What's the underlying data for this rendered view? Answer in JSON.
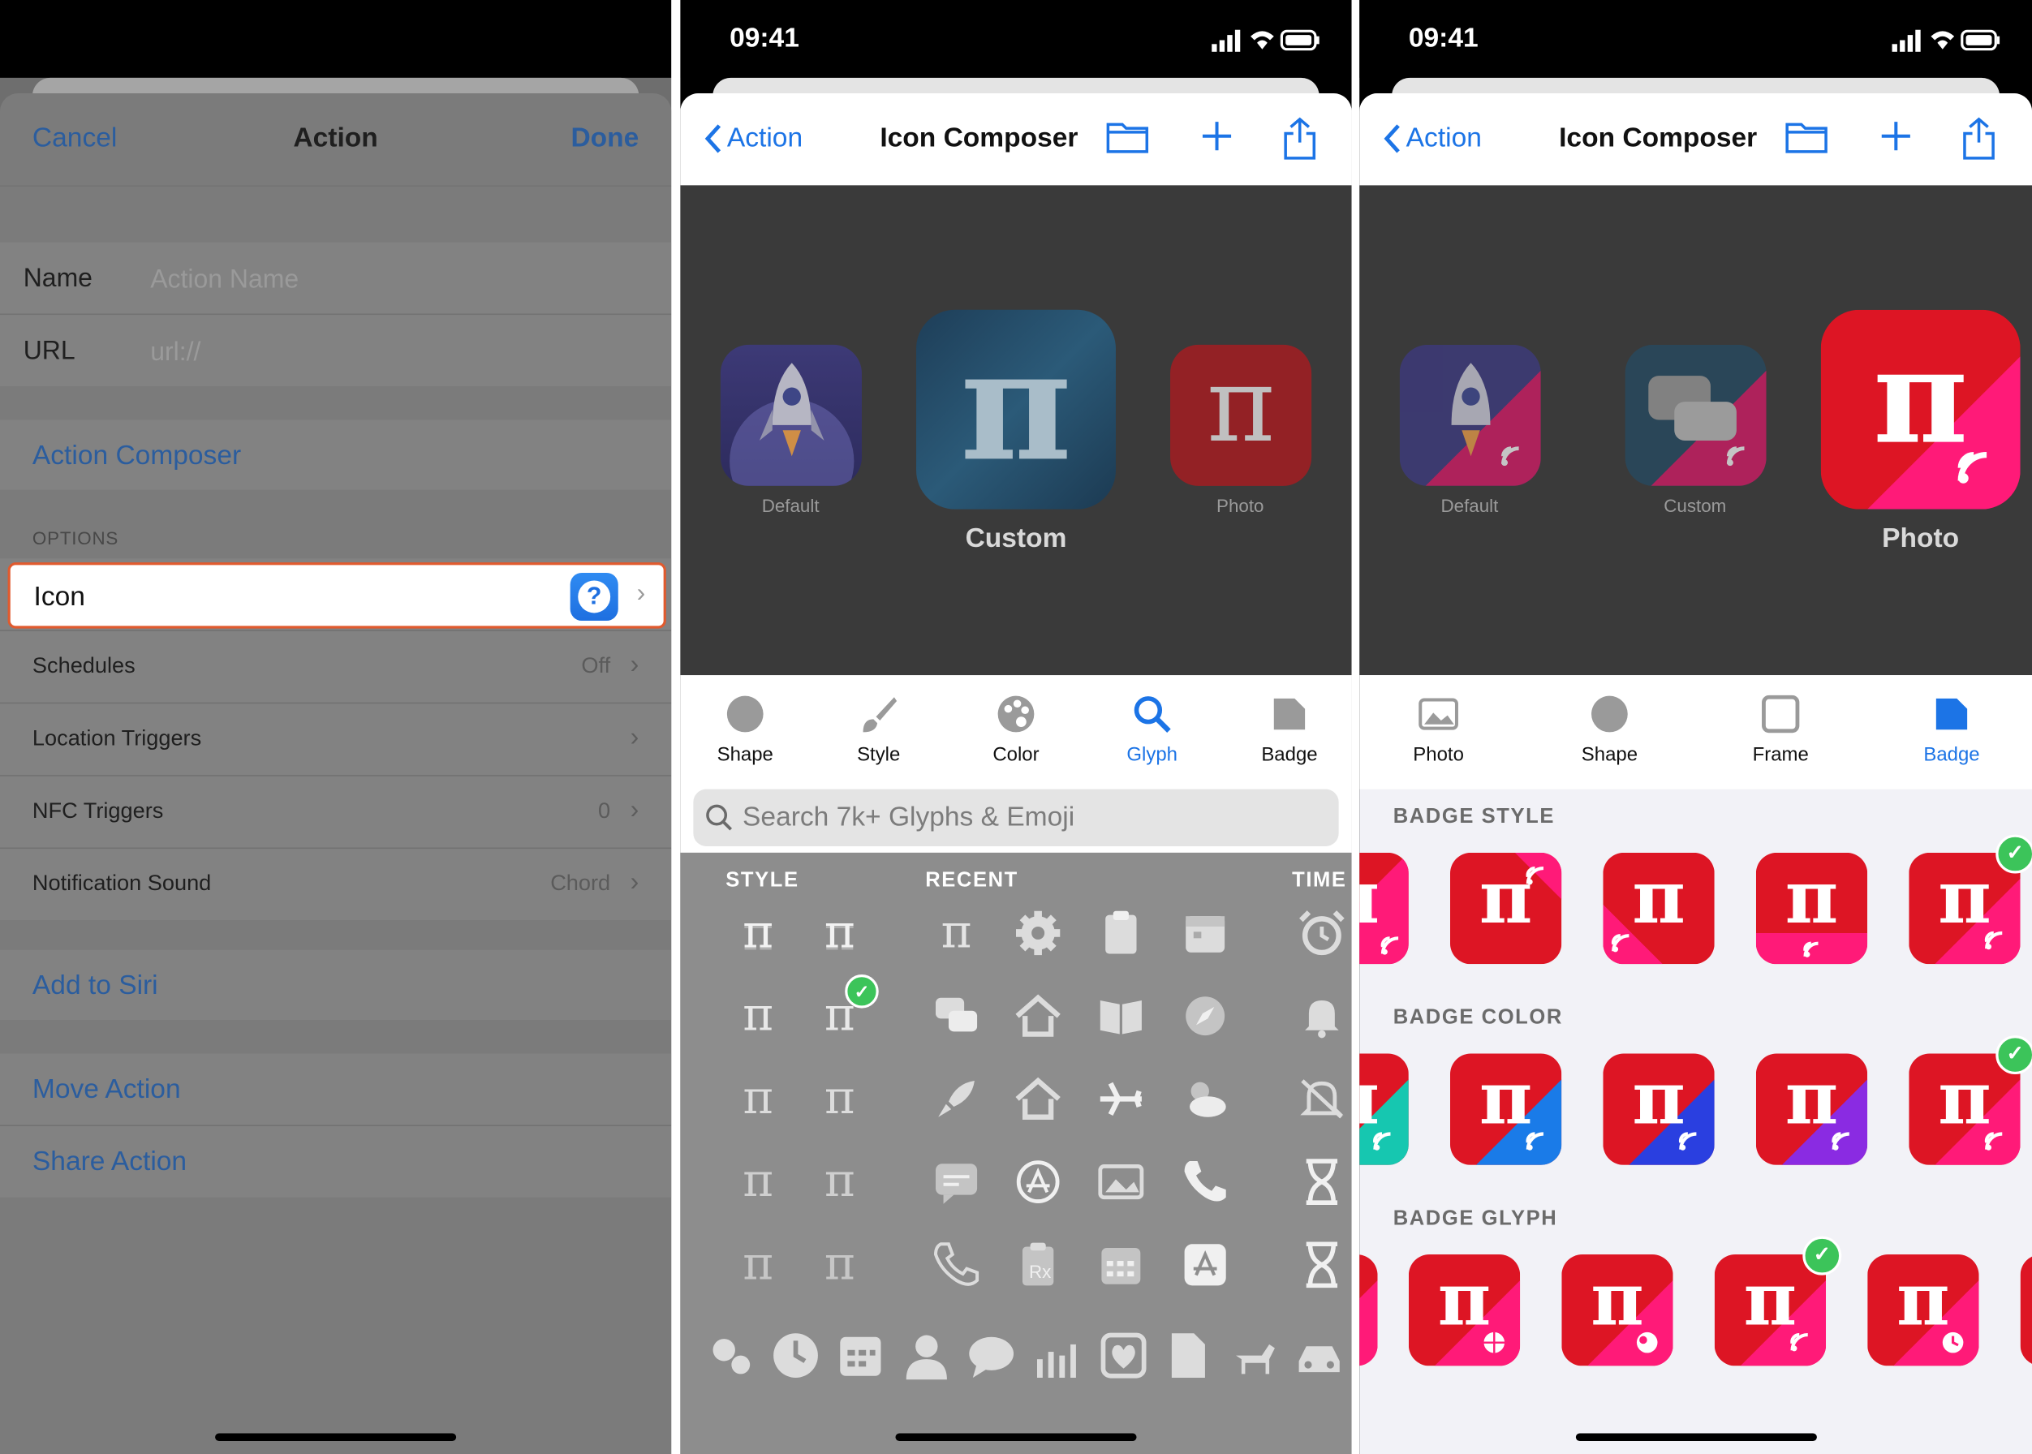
{
  "status_bar": {
    "time": "09:41"
  },
  "panel1": {
    "nav": {
      "cancel": "Cancel",
      "title": "Action",
      "done": "Done"
    },
    "name_label": "Name",
    "name_placeholder": "Action Name",
    "url_label": "URL",
    "url_placeholder": "url://",
    "action_composer": "Action Composer",
    "options_header": "OPTIONS",
    "icon_label": "Icon",
    "icon_glyph": "?",
    "rows": [
      {
        "label": "Schedules",
        "value": "Off"
      },
      {
        "label": "Location Triggers",
        "value": ""
      },
      {
        "label": "NFC Triggers",
        "value": "0"
      },
      {
        "label": "Notification Sound",
        "value": "Chord"
      }
    ],
    "add_to_siri": "Add to Siri",
    "move_action": "Move Action",
    "share_action": "Share Action"
  },
  "composer": {
    "back": "Action",
    "title": "Icon Composer"
  },
  "panel2": {
    "preview": {
      "default": "Default",
      "custom": "Custom",
      "photo": "Photo"
    },
    "tabs": [
      "Shape",
      "Style",
      "Color",
      "Glyph",
      "Badge"
    ],
    "active_tab": "Glyph",
    "search_placeholder": "Search 7k+ Glyphs & Emoji",
    "sections": [
      "STYLE",
      "RECENT",
      "TIME"
    ],
    "glyph_char": "π"
  },
  "panel3": {
    "preview": {
      "default": "Default",
      "custom": "Custom",
      "photo": "Photo"
    },
    "tabs": [
      "Photo",
      "Shape",
      "Frame",
      "Badge"
    ],
    "active_tab": "Badge",
    "sections": [
      "BADGE STYLE",
      "BADGE COLOR",
      "BADGE GLYPH"
    ],
    "glyph_char": "π"
  },
  "colors": {
    "accent": "#1c74e6",
    "highlight_border": "#e05a2e",
    "tile_red": "#dd1524",
    "badge_pink": "#ff1a78",
    "check_green": "#3cc45a"
  }
}
